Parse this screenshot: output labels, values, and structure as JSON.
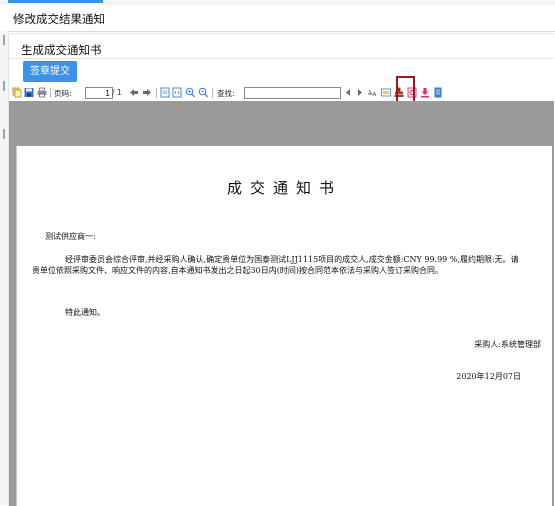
{
  "window": {
    "title": "修改成交结果通知"
  },
  "panel": {
    "title": "生成成交通知书",
    "submit_label": "签章提交"
  },
  "toolbar": {
    "page_label": "页码:",
    "current_page": "1",
    "total_pages": "/ 1",
    "find_label": "查找:",
    "find_value": "",
    "icons": [
      "copy-icon",
      "save-icon",
      "print-icon",
      "prev-page-icon",
      "next-page-icon",
      "fit-page-icon",
      "fit-width-icon",
      "zoom-in-icon",
      "zoom-out-icon",
      "find-prev-icon",
      "find-next-icon",
      "match-case-icon",
      "highlight-icon",
      "stamp-icon",
      "export-pdf-icon",
      "download-icon",
      "document-icon"
    ],
    "colors": {
      "highlight_frame": "#a0141b",
      "submit_button": "#3d91e8",
      "viewer_background": "#9a9a9a"
    }
  },
  "document": {
    "title": "成交通知书",
    "recipient": "测试供应商一:",
    "body": "经评审委员会综合评审,并经采购人确认,确定贵单位为国泰测试LJJ1115项目的成交人,成交金额:CNY 99.99 %,履约期限:无。请贵单位依照采购文件、响应文件的内容,自本通知书发出之日起30日内(时间)按合同范本依法与采购人签订采购合同。",
    "notice": "特此通知。",
    "purchaser": "采购人:系统管理部",
    "date": "2020年12月07日"
  }
}
